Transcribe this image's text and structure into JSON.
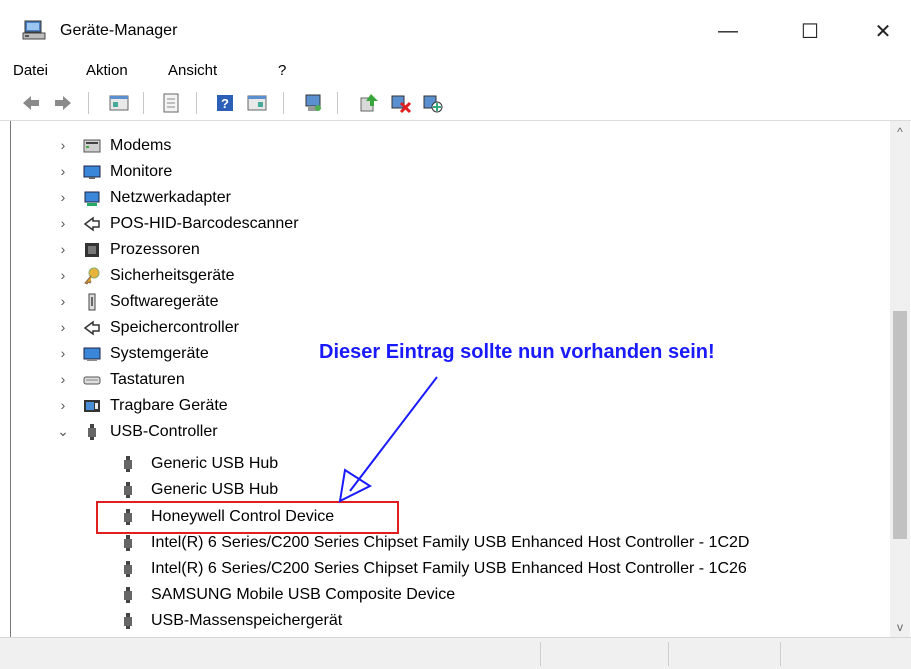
{
  "window": {
    "title": "Geräte-Manager",
    "minimize_glyph": "—",
    "maximize_glyph": "☐",
    "close_glyph": "✕"
  },
  "menu": {
    "items": [
      "Datei",
      "Aktion",
      "Ansicht",
      "?"
    ]
  },
  "toolbar": {
    "buttons": [
      "back-icon",
      "forward-icon",
      "properties-icon",
      "scan-icon",
      "help-icon",
      "view-icon",
      "monitor-icon",
      "update-driver-icon",
      "uninstall-icon",
      "enable-icon"
    ]
  },
  "tree": {
    "categories": [
      {
        "label": "Modems",
        "expander": "›",
        "icon": "modem-icon"
      },
      {
        "label": "Monitore",
        "expander": "›",
        "icon": "monitor-icon"
      },
      {
        "label": "Netzwerkadapter",
        "expander": "›",
        "icon": "network-adapter-icon"
      },
      {
        "label": "POS-HID-Barcodescanner",
        "expander": "›",
        "icon": "barcode-scanner-icon"
      },
      {
        "label": "Prozessoren",
        "expander": "›",
        "icon": "processor-icon"
      },
      {
        "label": "Sicherheitsgeräte",
        "expander": "›",
        "icon": "security-key-icon"
      },
      {
        "label": "Softwaregeräte",
        "expander": "›",
        "icon": "software-device-icon"
      },
      {
        "label": "Speichercontroller",
        "expander": "›",
        "icon": "storage-controller-icon"
      },
      {
        "label": "Systemgeräte",
        "expander": "›",
        "icon": "system-device-icon"
      },
      {
        "label": "Tastaturen",
        "expander": "›",
        "icon": "keyboard-icon"
      },
      {
        "label": "Tragbare Geräte",
        "expander": "›",
        "icon": "portable-device-icon"
      },
      {
        "label": "USB-Controller",
        "expander": "⌄",
        "icon": "usb-icon"
      }
    ],
    "usb_children": [
      "Generic USB Hub",
      "Generic USB Hub",
      "Honeywell Control Device",
      "Intel(R) 6 Series/C200 Series Chipset Family USB Enhanced Host Controller - 1C2D",
      "Intel(R) 6 Series/C200 Series Chipset Family USB Enhanced Host Controller - 1C26",
      "SAMSUNG Mobile USB Composite Device",
      "USB-Massenspeichergerät"
    ]
  },
  "annotation": {
    "text": "Dieser Eintrag sollte nun vorhanden sein!",
    "color": "#1a1aff",
    "highlight_color": "#e02020"
  },
  "scrollbar": {
    "up_glyph": "^",
    "down_glyph": "v"
  }
}
